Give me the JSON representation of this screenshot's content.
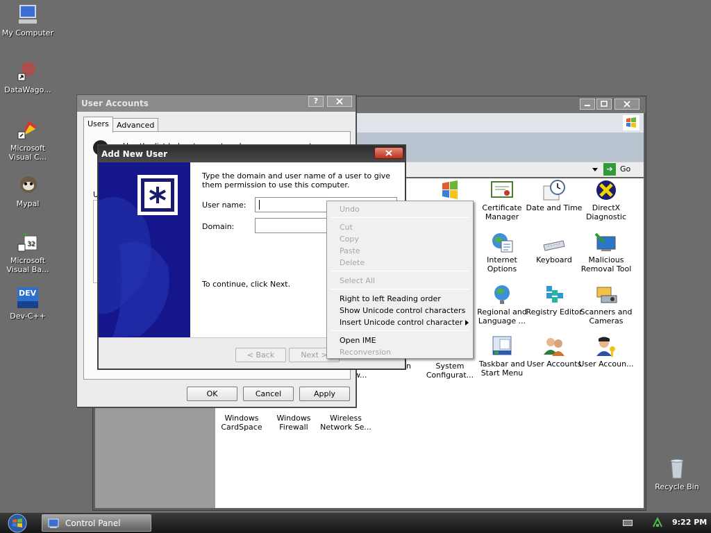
{
  "desktop": {
    "icons": [
      {
        "label": "My Computer",
        "icon": "computer-icon"
      },
      {
        "label": "DataWago...",
        "icon": "datawago-icon"
      },
      {
        "label": "Microsoft Visual C...",
        "icon": "visual-c-icon"
      },
      {
        "label": "Mypal",
        "icon": "mypal-icon"
      },
      {
        "label": "Microsoft Visual Ba...",
        "icon": "visual-basic-icon"
      },
      {
        "label": "Dev-C++",
        "icon": "devcpp-icon"
      },
      {
        "label": "Recycle Bin",
        "icon": "recycle-bin-icon"
      }
    ],
    "dev_badge": "DEV"
  },
  "control_panel": {
    "go_label": "Go",
    "items": [
      {
        "label": "",
        "icon": "windows-update-icon"
      },
      {
        "label": "Certificate Manager",
        "icon": "certificate-icon"
      },
      {
        "label": "Date and Time",
        "icon": "clock-icon"
      },
      {
        "label": "DirectX Diagnostic",
        "icon": "directx-icon"
      },
      {
        "label": "Internet Options",
        "icon": "globe-icon"
      },
      {
        "label": "Keyboard",
        "icon": "keyboard-icon"
      },
      {
        "label": "Malicious Removal Tool",
        "icon": "malicious-removal-icon"
      },
      {
        "label": "Regional and Language ...",
        "icon": "regional-globe-icon"
      },
      {
        "label": "Registry Editor",
        "icon": "registry-icon"
      },
      {
        "label": "Scanners and Cameras",
        "icon": "scanner-icon"
      },
      {
        "label": "System Configurat...",
        "icon": "system-config-icon"
      },
      {
        "label": "Taskbar and Start Menu",
        "icon": "taskbar-icon"
      },
      {
        "label": "User Accounts",
        "icon": "users-icon"
      },
      {
        "label": "User Accoun...",
        "icon": "user-key-icon"
      },
      {
        "label": "Windows CardSpace",
        "icon": "cardspace-icon"
      },
      {
        "label": "Windows Firewall",
        "icon": "firewall-icon"
      },
      {
        "label": "Wireless Network Se...",
        "icon": "wireless-icon"
      }
    ],
    "partial_texts": [
      "n",
      "w..."
    ]
  },
  "user_accounts": {
    "title": "User Accounts",
    "tabs": [
      "Users",
      "Advanced"
    ],
    "intro": "Use the list below to grant or deny users access to your",
    "u_partial": "U",
    "buttons": {
      "ok": "OK",
      "cancel": "Cancel",
      "apply": "Apply"
    }
  },
  "add_new_user": {
    "title": "Add New User",
    "description": "Type the domain and user name of a user to give them permission to use this computer.",
    "username_label": "User name:",
    "username_value": "",
    "domain_label": "Domain:",
    "domain_value": "",
    "continue_text": "To continue, click Next.",
    "back_button": "< Back",
    "next_button": "Next >"
  },
  "context_menu": {
    "items": [
      {
        "label": "Undo",
        "enabled": false
      },
      {
        "label": "Cut",
        "enabled": false
      },
      {
        "label": "Copy",
        "enabled": false
      },
      {
        "label": "Paste",
        "enabled": false
      },
      {
        "label": "Delete",
        "enabled": false
      },
      {
        "label": "Select All",
        "enabled": false
      },
      {
        "label": "Right to left Reading order",
        "enabled": true
      },
      {
        "label": "Show Unicode control characters",
        "enabled": true
      },
      {
        "label": "Insert Unicode control character",
        "enabled": true,
        "submenu": true
      },
      {
        "label": "Open IME",
        "enabled": true
      },
      {
        "label": "Reconversion",
        "enabled": false
      }
    ]
  },
  "taskbar": {
    "task_label": "Control Panel",
    "clock": "9:22 PM"
  }
}
